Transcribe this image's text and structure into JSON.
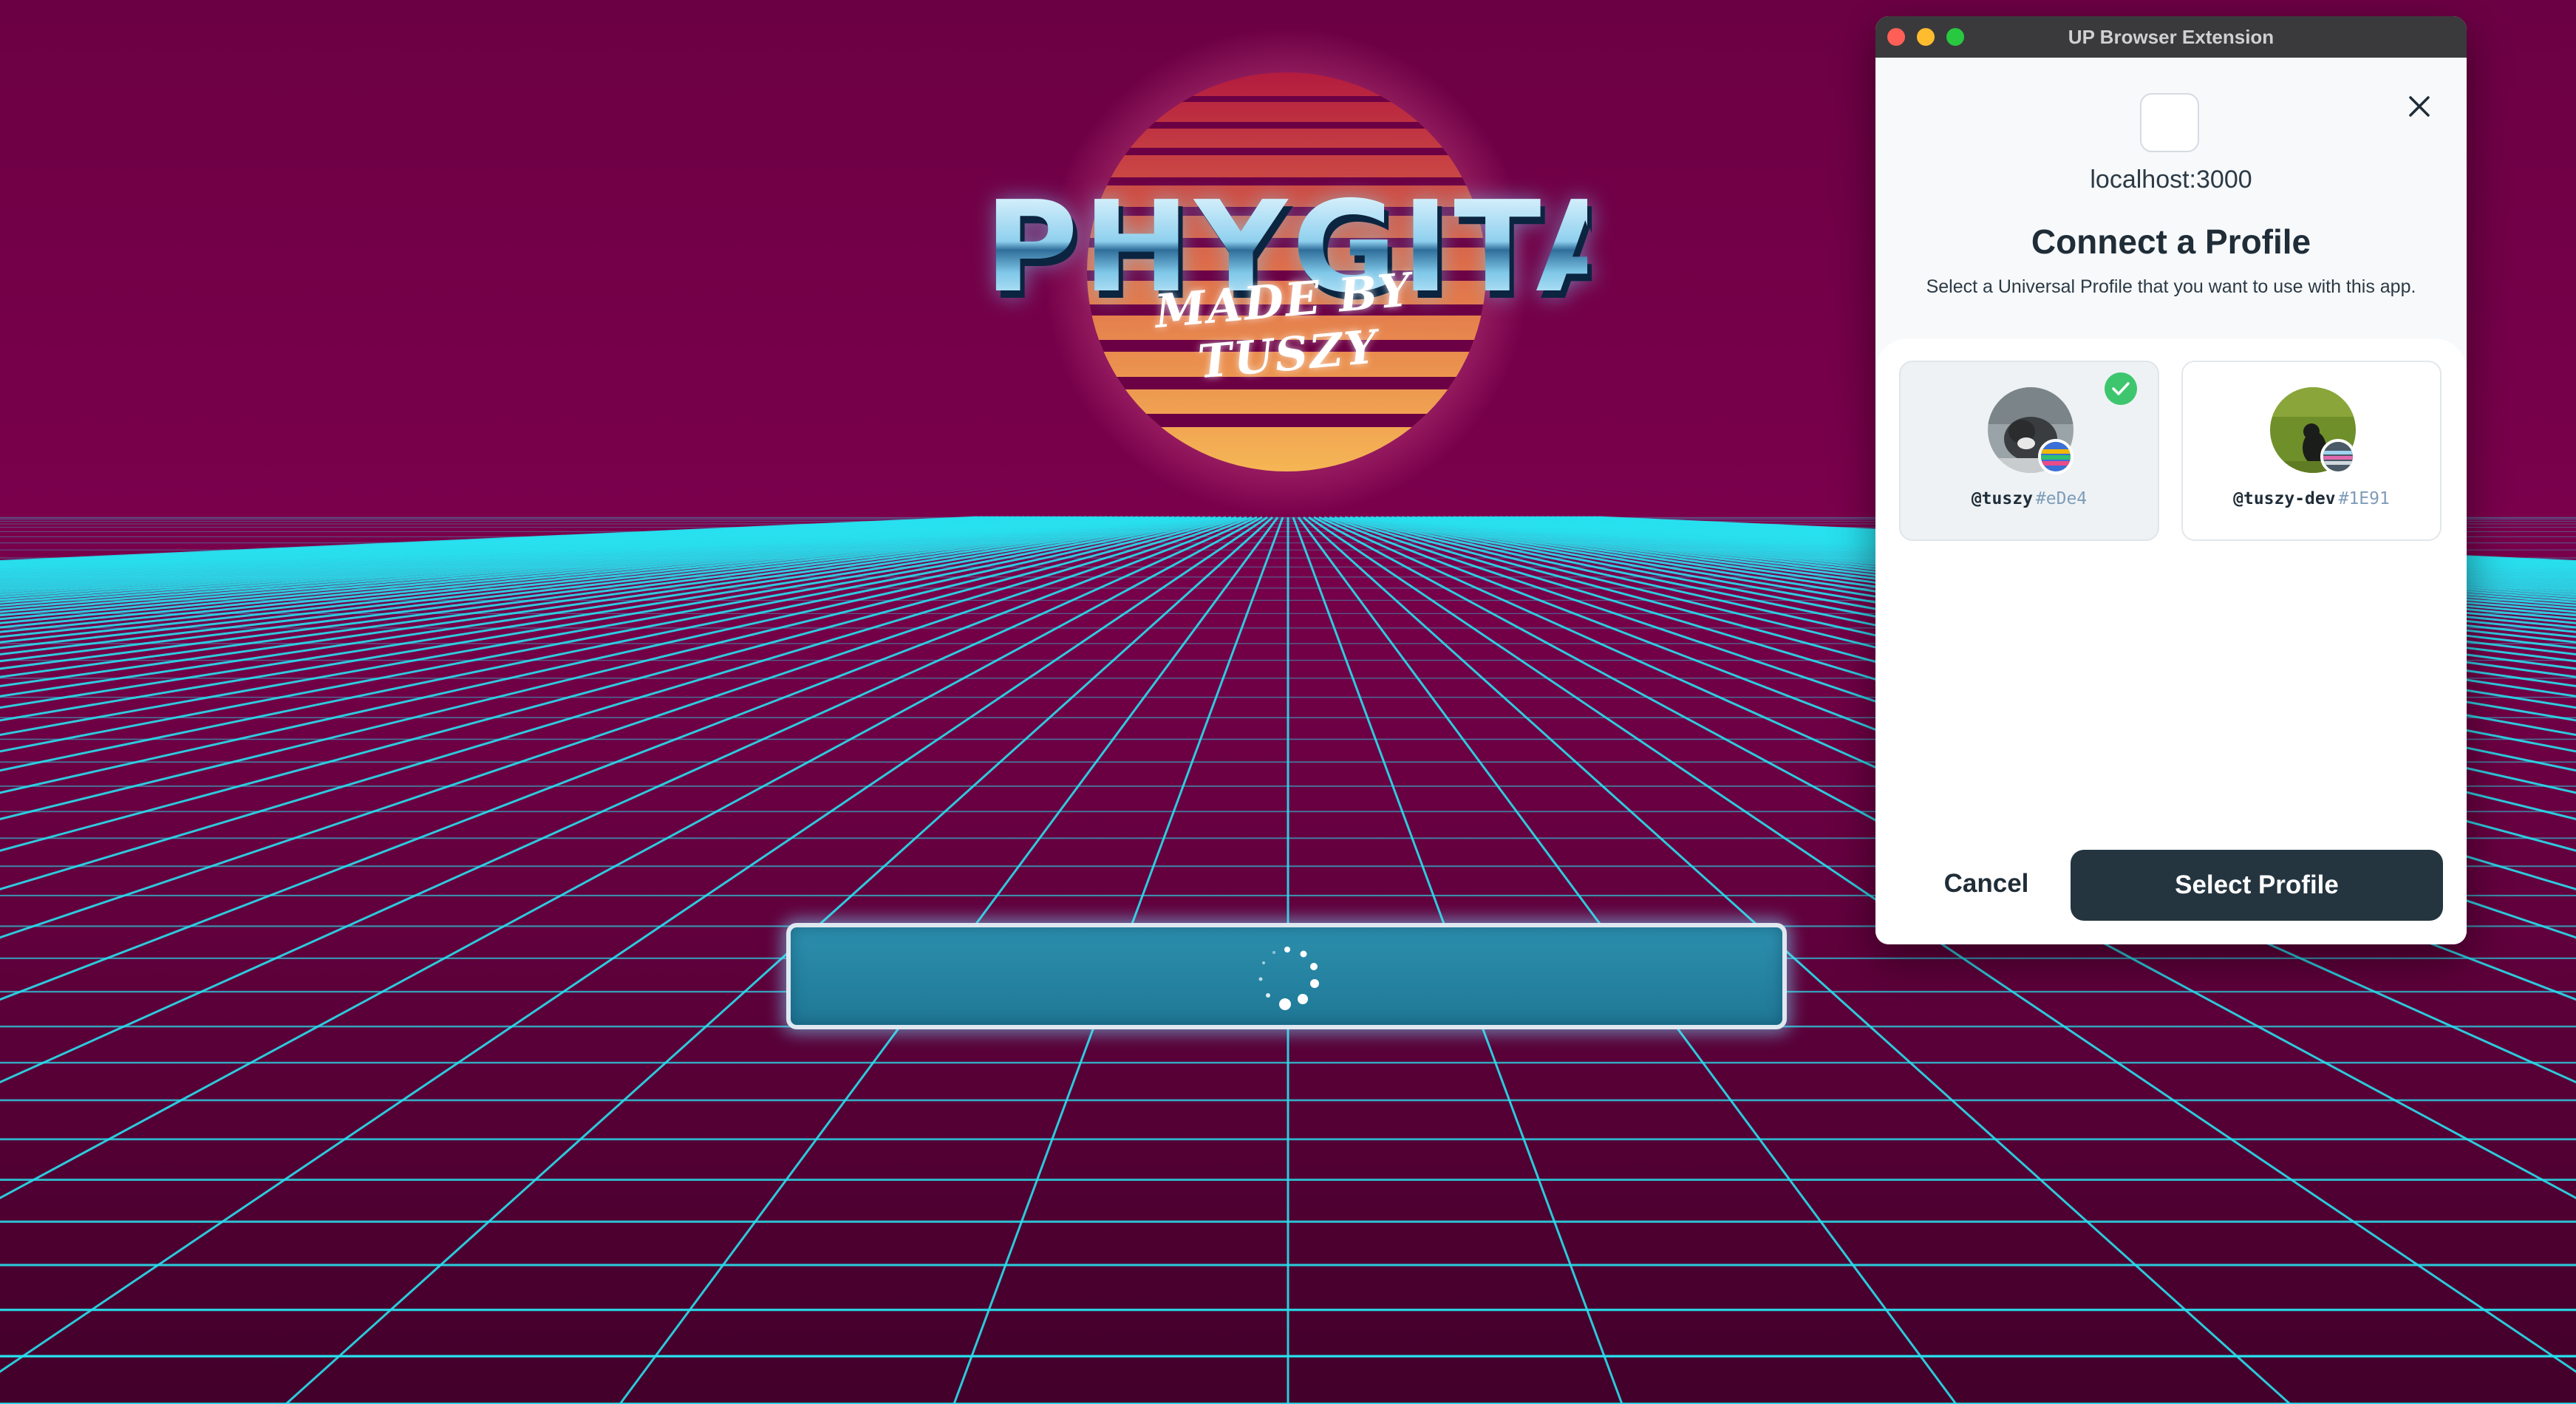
{
  "app": {
    "logo_title": "PHYGITAL",
    "logo_subtitle": "MADE BY TUSZY"
  },
  "extension": {
    "window_title": "UP Browser Extension",
    "host": "localhost:3000",
    "heading": "Connect a Profile",
    "subheading": "Select a Universal Profile that you want to use with this app.",
    "profiles": [
      {
        "handle": "@tuszy",
        "tag": "#eDe4",
        "selected": true
      },
      {
        "handle": "@tuszy-dev",
        "tag": "#1E91",
        "selected": false
      }
    ],
    "cancel_label": "Cancel",
    "select_label": "Select Profile"
  },
  "colors": {
    "background": "#5a0034",
    "grid_line": "#28e0ee",
    "loader": "#1f7896",
    "primary_button": "#243540",
    "check": "#3ec66e"
  }
}
